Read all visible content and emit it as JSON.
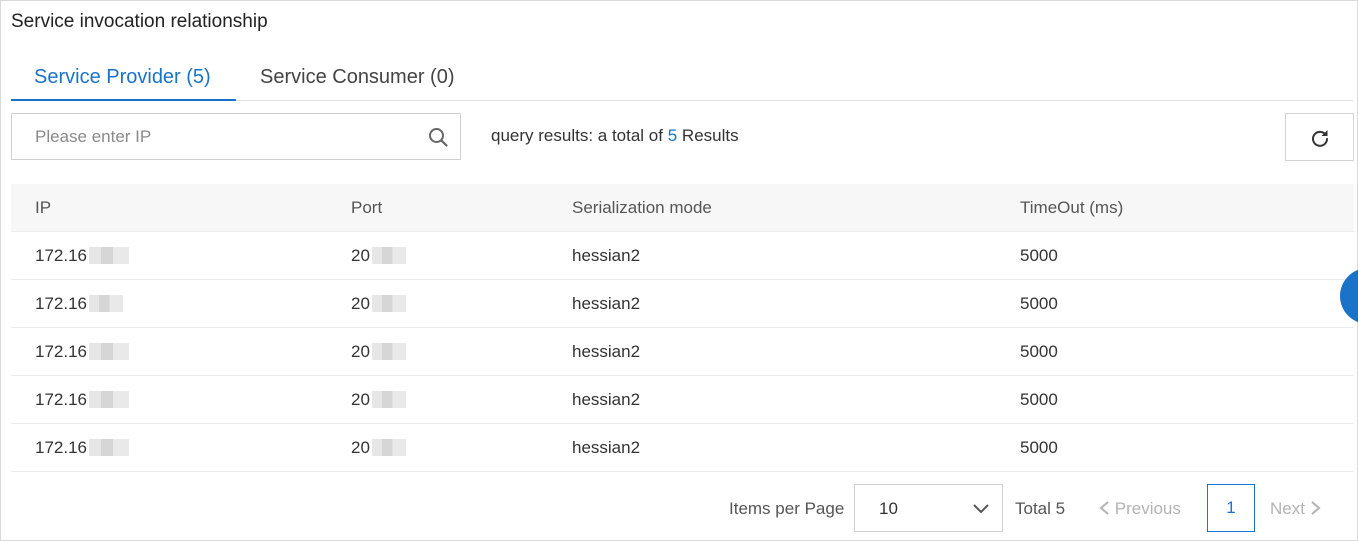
{
  "panel": {
    "title": "Service invocation relationship"
  },
  "tabs": [
    {
      "label": "Service Provider (5)",
      "active": true
    },
    {
      "label": "Service Consumer (0)",
      "active": false
    }
  ],
  "search": {
    "placeholder": "Please enter IP",
    "value": ""
  },
  "results": {
    "prefix": "query results: a total of",
    "count": "5",
    "suffix": "Results"
  },
  "table": {
    "columns": [
      "IP",
      "Port",
      "Serialization mode",
      "TimeOut (ms)"
    ],
    "rows": [
      {
        "ip": "172.16",
        "port": "20",
        "serialization": "hessian2",
        "timeout": "5000"
      },
      {
        "ip": "172.16",
        "port": "20",
        "serialization": "hessian2",
        "timeout": "5000"
      },
      {
        "ip": "172.16",
        "port": "20",
        "serialization": "hessian2",
        "timeout": "5000"
      },
      {
        "ip": "172.16",
        "port": "20",
        "serialization": "hessian2",
        "timeout": "5000"
      },
      {
        "ip": "172.16",
        "port": "20",
        "serialization": "hessian2",
        "timeout": "5000"
      }
    ]
  },
  "pagination": {
    "items_per_page_label": "Items per Page",
    "page_size": "10",
    "total_label": "Total 5",
    "previous_label": "Previous",
    "current_page": "1",
    "next_label": "Next"
  },
  "icons": {
    "search": "search-icon",
    "refresh": "refresh-icon",
    "dropdown": "chevron-down-icon",
    "prev": "chevron-left-icon",
    "next": "chevron-right-icon"
  },
  "colors": {
    "accent": "#1b73c9",
    "header_bg": "#f7f7f7",
    "border": "#d9d9d9"
  }
}
